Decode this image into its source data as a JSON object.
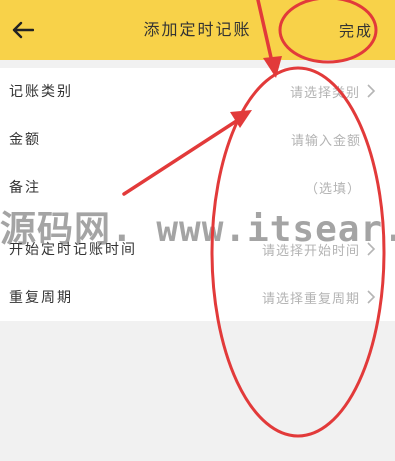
{
  "header": {
    "back_icon": "arrow-left-icon",
    "title": "添加定时记账",
    "done_label": "完成"
  },
  "form": {
    "rows": [
      {
        "label": "记账类别",
        "value": "请选择类别",
        "has_arrow": true
      },
      {
        "label": "金额",
        "value": "请输入金额",
        "has_arrow": false
      },
      {
        "label": "备注",
        "value": "（选填）",
        "has_arrow": false
      },
      {
        "label": "开始定时记账时间",
        "value": "请选择开始时间",
        "has_arrow": true
      },
      {
        "label": "重复周期",
        "value": "请选择重复周期",
        "has_arrow": true
      }
    ]
  },
  "watermark": {
    "text": "源码网. www.itsear."
  },
  "colors": {
    "header_bg": "#f8d249",
    "page_bg": "#f1f1f1",
    "annotation": "#e23a3a"
  }
}
